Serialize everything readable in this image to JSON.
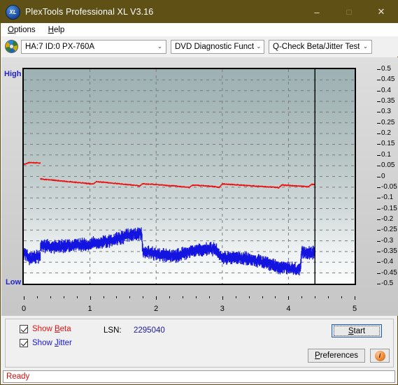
{
  "window": {
    "title": "PlexTools Professional XL V3.16",
    "icon": "xl-logo-icon",
    "minimize": "–",
    "maximize": "□",
    "close": "✕"
  },
  "menubar": {
    "items": [
      {
        "label": "Options",
        "accel": "O"
      },
      {
        "label": "Help",
        "accel": "H"
      }
    ]
  },
  "toolbar": {
    "drive_icon": "disc-icon",
    "drive": {
      "value": "HA:7 ID:0  PX-760A",
      "arrow": "⌄"
    },
    "function": {
      "value": "DVD Diagnostic Functions",
      "arrow": "⌄"
    },
    "test": {
      "value": "Q-Check Beta/Jitter Test",
      "arrow": "⌄"
    }
  },
  "chart_data": {
    "type": "line",
    "title": "Q-Check Beta/Jitter Test",
    "xlabel": "",
    "ylabel": "",
    "axis_labels": {
      "top": "High",
      "bottom": "Low"
    },
    "xlim": [
      0,
      5
    ],
    "ylim": [
      -0.5,
      0.5
    ],
    "xticks": [
      0,
      1,
      2,
      3,
      4,
      5
    ],
    "xtick_labels": [
      "0",
      "1",
      "2",
      "3",
      "4",
      "5"
    ],
    "yticks": [
      0.5,
      0.45,
      0.4,
      0.35,
      0.3,
      0.25,
      0.2,
      0.15,
      0.1,
      0.05,
      0,
      -0.05,
      -0.1,
      -0.15,
      -0.2,
      -0.25,
      -0.3,
      -0.35,
      -0.4,
      -0.45,
      -0.5
    ],
    "ytick_labels": [
      "0.5",
      "0.45",
      "0.4",
      "0.35",
      "0.3",
      "0.25",
      "0.2",
      "0.15",
      "0.1",
      "0.05",
      "0",
      "-0.05",
      "-0.1",
      "-0.15",
      "-0.2",
      "-0.25",
      "-0.3",
      "-0.35",
      "-0.4",
      "-0.45",
      "-0.5"
    ],
    "grid": true,
    "legend_position": "below-left",
    "cursor_x": 4.4,
    "data_end_x": 4.4,
    "series": [
      {
        "name": "Beta",
        "color": "#ee1111",
        "x": [
          0.0,
          0.05,
          0.1,
          0.15,
          0.2,
          0.25,
          0.26,
          0.3,
          0.4,
          0.5,
          0.6,
          0.7,
          0.8,
          0.9,
          1.0,
          1.05,
          1.1,
          1.2,
          1.3,
          1.4,
          1.5,
          1.6,
          1.7,
          1.75,
          1.8,
          1.9,
          2.0,
          2.1,
          2.2,
          2.3,
          2.4,
          2.5,
          2.55,
          2.6,
          2.7,
          2.8,
          2.9,
          2.95,
          3.0,
          3.1,
          3.2,
          3.3,
          3.4,
          3.5,
          3.6,
          3.7,
          3.8,
          3.85,
          3.9,
          4.0,
          4.1,
          4.2,
          4.3,
          4.35,
          4.4
        ],
        "y": [
          0.055,
          0.062,
          0.065,
          0.064,
          0.063,
          0.062,
          -0.012,
          -0.013,
          -0.016,
          -0.019,
          -0.022,
          -0.025,
          -0.028,
          -0.031,
          -0.034,
          -0.036,
          -0.024,
          -0.027,
          -0.03,
          -0.033,
          -0.036,
          -0.039,
          -0.042,
          -0.045,
          -0.034,
          -0.036,
          -0.038,
          -0.04,
          -0.043,
          -0.045,
          -0.048,
          -0.052,
          -0.04,
          -0.041,
          -0.043,
          -0.045,
          -0.048,
          -0.052,
          -0.035,
          -0.037,
          -0.039,
          -0.041,
          -0.043,
          -0.045,
          -0.047,
          -0.049,
          -0.051,
          -0.053,
          -0.04,
          -0.042,
          -0.044,
          -0.046,
          -0.048,
          -0.037,
          -0.038
        ],
        "band": 0.006
      },
      {
        "name": "Jitter",
        "color": "#1515e0",
        "x": [
          0.0,
          0.05,
          0.1,
          0.15,
          0.2,
          0.25,
          0.26,
          0.3,
          0.4,
          0.5,
          0.6,
          0.7,
          0.8,
          0.9,
          1.0,
          1.1,
          1.2,
          1.3,
          1.4,
          1.5,
          1.6,
          1.7,
          1.78,
          1.8,
          1.9,
          2.0,
          2.1,
          2.2,
          2.3,
          2.4,
          2.5,
          2.6,
          2.7,
          2.8,
          2.9,
          3.0,
          3.1,
          3.2,
          3.3,
          3.4,
          3.5,
          3.6,
          3.7,
          3.8,
          3.9,
          4.0,
          4.1,
          4.18,
          4.2,
          4.3,
          4.4
        ],
        "y": [
          -0.355,
          -0.37,
          -0.385,
          -0.38,
          -0.375,
          -0.372,
          -0.32,
          -0.322,
          -0.325,
          -0.328,
          -0.325,
          -0.322,
          -0.32,
          -0.318,
          -0.315,
          -0.312,
          -0.305,
          -0.298,
          -0.29,
          -0.282,
          -0.272,
          -0.268,
          -0.265,
          -0.35,
          -0.355,
          -0.362,
          -0.365,
          -0.372,
          -0.368,
          -0.36,
          -0.352,
          -0.345,
          -0.34,
          -0.338,
          -0.342,
          -0.375,
          -0.38,
          -0.378,
          -0.382,
          -0.385,
          -0.392,
          -0.398,
          -0.41,
          -0.418,
          -0.425,
          -0.428,
          -0.432,
          -0.435,
          -0.355,
          -0.352,
          -0.358
        ],
        "band": 0.045
      }
    ]
  },
  "controls": {
    "show_beta": {
      "label": "Show Beta",
      "accel": "B",
      "checked": true,
      "color": "#ee1111"
    },
    "show_jitter": {
      "label": "Show Jitter",
      "accel": "J",
      "checked": true,
      "color": "#1515e0"
    },
    "lsn_label": "LSN:",
    "lsn_value": "2295040",
    "start_button": {
      "label": "Start",
      "accel": "S"
    },
    "preferences_button": {
      "label": "Preferences",
      "accel": "P"
    },
    "info_button": {
      "glyph": "i"
    }
  },
  "statusbar": {
    "text": "Ready"
  }
}
